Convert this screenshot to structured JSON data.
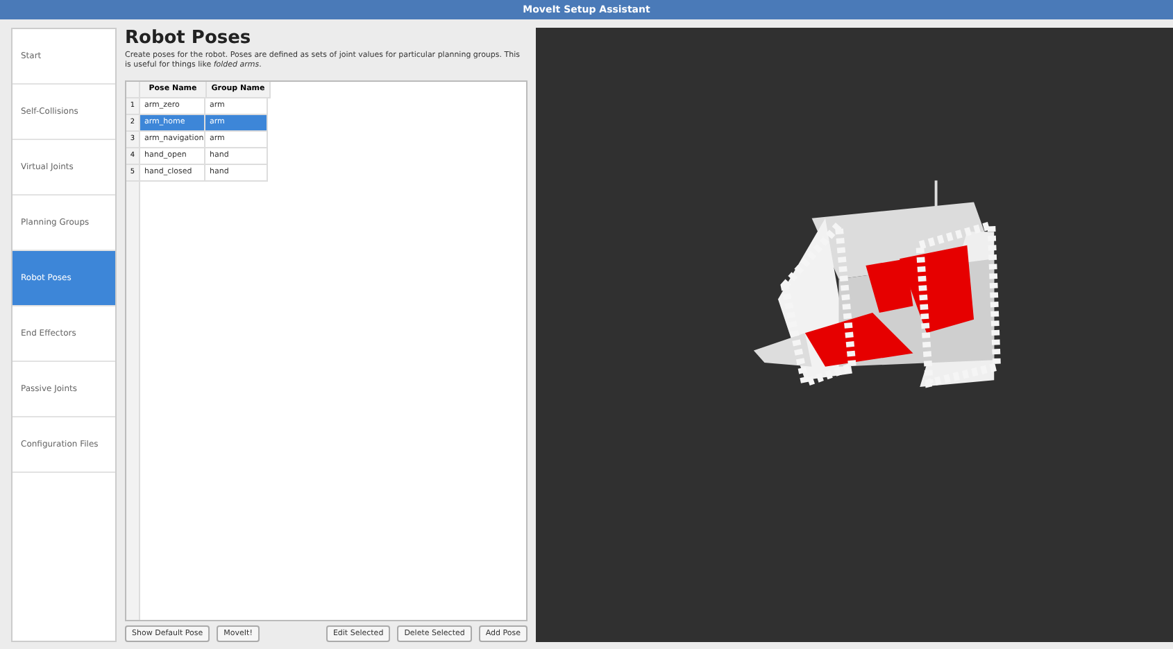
{
  "window": {
    "title": "MoveIt Setup Assistant"
  },
  "sidebar": {
    "items": [
      {
        "label": "Start",
        "selected": false
      },
      {
        "label": "Self-Collisions",
        "selected": false
      },
      {
        "label": "Virtual Joints",
        "selected": false
      },
      {
        "label": "Planning Groups",
        "selected": false
      },
      {
        "label": "Robot Poses",
        "selected": true
      },
      {
        "label": "End Effectors",
        "selected": false
      },
      {
        "label": "Passive Joints",
        "selected": false
      },
      {
        "label": "Configuration Files",
        "selected": false
      }
    ]
  },
  "page": {
    "title": "Robot Poses",
    "description": "Create poses for the robot. Poses are defined as sets of joint values for particular planning groups. This is useful for things like *folded arms*."
  },
  "table": {
    "columns": [
      "Pose Name",
      "Group Name"
    ],
    "rows": [
      {
        "index": "1",
        "cells": [
          "arm_zero",
          "arm"
        ],
        "selected": false
      },
      {
        "index": "2",
        "cells": [
          "arm_home",
          "arm"
        ],
        "selected": true
      },
      {
        "index": "3",
        "cells": [
          "arm_navigation",
          "arm"
        ],
        "selected": false
      },
      {
        "index": "4",
        "cells": [
          "hand_open",
          "hand"
        ],
        "selected": false
      },
      {
        "index": "5",
        "cells": [
          "hand_closed",
          "hand"
        ],
        "selected": false
      }
    ]
  },
  "buttons_left": [
    "Show Default Pose",
    "MoveIt!"
  ],
  "buttons_right": [
    "Edit Selected",
    "Delete Selected",
    "Add Pose"
  ],
  "viewport": {
    "kind": "picture"
  }
}
